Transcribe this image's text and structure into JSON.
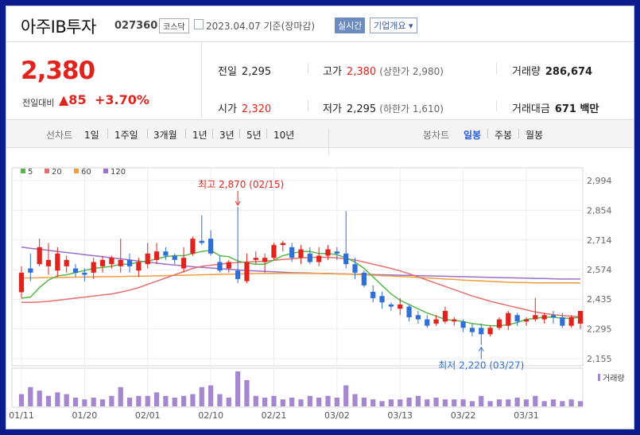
{
  "header": {
    "name": "아주IB투자",
    "code": "027360",
    "market": "코스닥",
    "date": "2023.04.07 기준(장마감)",
    "live": "실시간",
    "info": "기업개요 ▾"
  },
  "price": {
    "current": "2,380",
    "change_label": "전일대비",
    "change": "▲85",
    "percent": "+3.70%"
  },
  "stats": {
    "prev_label": "전일",
    "prev": "2,295",
    "high_label": "고가",
    "high": "2,380",
    "upper_limit": "(상한가 2,980)",
    "volume_label": "거래량",
    "volume": "286,674",
    "open_label": "시가",
    "open": "2,320",
    "low_label": "저가",
    "low": "2,295",
    "lower_limit": "(하한가 1,610)",
    "amount_label": "거래대금",
    "amount": "671 백만"
  },
  "controls": {
    "line_label": "선차트",
    "periods": [
      "1일",
      "1주일",
      "3개월",
      "1년",
      "3년",
      "5년",
      "10년"
    ],
    "candle_label": "봉차트",
    "candles": [
      "일봉",
      "주봉",
      "월봉"
    ],
    "active_candle": "일봉"
  },
  "colors": {
    "up": "#e0231c",
    "down": "#2f6fd6",
    "ma5": "#57b847",
    "ma20": "#e56f6f",
    "ma60": "#f29d3e",
    "ma120": "#9a70c9",
    "volume": "#a487cf"
  },
  "chart_data": {
    "type": "candlestick",
    "legend": [
      {
        "name": "5",
        "color": "#57b847"
      },
      {
        "name": "20",
        "color": "#e56f6f"
      },
      {
        "name": "60",
        "color": "#f29d3e"
      },
      {
        "name": "120",
        "color": "#9a70c9"
      }
    ],
    "y_ticks": [
      "2,994",
      "2,854",
      "2,714",
      "2,574",
      "2,435",
      "2,295",
      "2,155"
    ],
    "ylim": [
      2155,
      2994
    ],
    "x_ticks": [
      "01/11",
      "01/20",
      "02/01",
      "02/10",
      "02/21",
      "03/02",
      "03/13",
      "03/22",
      "03/31"
    ],
    "x_tick_index": [
      0,
      7,
      14,
      21,
      28,
      35,
      42,
      49,
      56
    ],
    "annotations": {
      "high": {
        "text": "최고 2,870 (02/15)",
        "index": 24,
        "value": 2870
      },
      "low": {
        "text": "최저 2,220 (03/27)",
        "index": 51,
        "value": 2220
      }
    },
    "volume_label": "거래량",
    "candles": [
      {
        "o": 2468,
        "h": 2590,
        "l": 2440,
        "c": 2560
      },
      {
        "o": 2580,
        "h": 2650,
        "l": 2520,
        "c": 2560
      },
      {
        "o": 2600,
        "h": 2720,
        "l": 2590,
        "c": 2680
      },
      {
        "o": 2590,
        "h": 2700,
        "l": 2550,
        "c": 2620
      },
      {
        "o": 2570,
        "h": 2680,
        "l": 2540,
        "c": 2650
      },
      {
        "o": 2590,
        "h": 2640,
        "l": 2560,
        "c": 2620
      },
      {
        "o": 2580,
        "h": 2600,
        "l": 2540,
        "c": 2560
      },
      {
        "o": 2560,
        "h": 2580,
        "l": 2520,
        "c": 2550
      },
      {
        "o": 2560,
        "h": 2630,
        "l": 2530,
        "c": 2610
      },
      {
        "o": 2590,
        "h": 2640,
        "l": 2560,
        "c": 2620
      },
      {
        "o": 2600,
        "h": 2640,
        "l": 2580,
        "c": 2630
      },
      {
        "o": 2590,
        "h": 2720,
        "l": 2560,
        "c": 2620
      },
      {
        "o": 2620,
        "h": 2650,
        "l": 2560,
        "c": 2590
      },
      {
        "o": 2570,
        "h": 2630,
        "l": 2540,
        "c": 2610
      },
      {
        "o": 2600,
        "h": 2700,
        "l": 2580,
        "c": 2650
      },
      {
        "o": 2620,
        "h": 2700,
        "l": 2600,
        "c": 2660
      },
      {
        "o": 2660,
        "h": 2680,
        "l": 2620,
        "c": 2640
      },
      {
        "o": 2640,
        "h": 2650,
        "l": 2600,
        "c": 2620
      },
      {
        "o": 2580,
        "h": 2680,
        "l": 2560,
        "c": 2630
      },
      {
        "o": 2650,
        "h": 2730,
        "l": 2640,
        "c": 2720
      },
      {
        "o": 2710,
        "h": 2830,
        "l": 2690,
        "c": 2700
      },
      {
        "o": 2720,
        "h": 2760,
        "l": 2640,
        "c": 2650
      },
      {
        "o": 2610,
        "h": 2640,
        "l": 2560,
        "c": 2570
      },
      {
        "o": 2580,
        "h": 2620,
        "l": 2560,
        "c": 2610
      },
      {
        "o": 2570,
        "h": 2870,
        "l": 2510,
        "c": 2530
      },
      {
        "o": 2520,
        "h": 2650,
        "l": 2510,
        "c": 2610
      },
      {
        "o": 2620,
        "h": 2660,
        "l": 2600,
        "c": 2630
      },
      {
        "o": 2610,
        "h": 2650,
        "l": 2560,
        "c": 2630
      },
      {
        "o": 2630,
        "h": 2700,
        "l": 2620,
        "c": 2690
      },
      {
        "o": 2690,
        "h": 2710,
        "l": 2660,
        "c": 2700
      },
      {
        "o": 2680,
        "h": 2700,
        "l": 2610,
        "c": 2630
      },
      {
        "o": 2630,
        "h": 2690,
        "l": 2600,
        "c": 2670
      },
      {
        "o": 2650,
        "h": 2680,
        "l": 2600,
        "c": 2610
      },
      {
        "o": 2610,
        "h": 2680,
        "l": 2590,
        "c": 2640
      },
      {
        "o": 2640,
        "h": 2690,
        "l": 2620,
        "c": 2670
      },
      {
        "o": 2660,
        "h": 2680,
        "l": 2620,
        "c": 2650
      },
      {
        "o": 2650,
        "h": 2850,
        "l": 2580,
        "c": 2600
      },
      {
        "o": 2600,
        "h": 2630,
        "l": 2530,
        "c": 2560
      },
      {
        "o": 2560,
        "h": 2570,
        "l": 2490,
        "c": 2500
      },
      {
        "o": 2470,
        "h": 2500,
        "l": 2420,
        "c": 2440
      },
      {
        "o": 2450,
        "h": 2470,
        "l": 2390,
        "c": 2420
      },
      {
        "o": 2410,
        "h": 2420,
        "l": 2380,
        "c": 2400
      },
      {
        "o": 2390,
        "h": 2440,
        "l": 2360,
        "c": 2410
      },
      {
        "o": 2400,
        "h": 2410,
        "l": 2330,
        "c": 2350
      },
      {
        "o": 2360,
        "h": 2380,
        "l": 2320,
        "c": 2340
      },
      {
        "o": 2340,
        "h": 2360,
        "l": 2300,
        "c": 2310
      },
      {
        "o": 2320,
        "h": 2360,
        "l": 2310,
        "c": 2340
      },
      {
        "o": 2330,
        "h": 2400,
        "l": 2320,
        "c": 2380
      },
      {
        "o": 2330,
        "h": 2350,
        "l": 2310,
        "c": 2340
      },
      {
        "o": 2330,
        "h": 2340,
        "l": 2280,
        "c": 2300
      },
      {
        "o": 2300,
        "h": 2320,
        "l": 2260,
        "c": 2280
      },
      {
        "o": 2300,
        "h": 2320,
        "l": 2220,
        "c": 2270
      },
      {
        "o": 2270,
        "h": 2310,
        "l": 2260,
        "c": 2300
      },
      {
        "o": 2300,
        "h": 2350,
        "l": 2290,
        "c": 2340
      },
      {
        "o": 2310,
        "h": 2380,
        "l": 2290,
        "c": 2370
      },
      {
        "o": 2360,
        "h": 2370,
        "l": 2310,
        "c": 2330
      },
      {
        "o": 2330,
        "h": 2350,
        "l": 2310,
        "c": 2340
      },
      {
        "o": 2340,
        "h": 2440,
        "l": 2330,
        "c": 2360
      },
      {
        "o": 2340,
        "h": 2370,
        "l": 2320,
        "c": 2360
      },
      {
        "o": 2360,
        "h": 2380,
        "l": 2320,
        "c": 2350
      },
      {
        "o": 2350,
        "h": 2370,
        "l": 2300,
        "c": 2310
      },
      {
        "o": 2310,
        "h": 2360,
        "l": 2300,
        "c": 2350
      },
      {
        "o": 2320,
        "h": 2380,
        "l": 2295,
        "c": 2380
      }
    ],
    "volume": [
      0.35,
      0.55,
      0.45,
      0.3,
      0.4,
      0.35,
      0.25,
      0.2,
      0.25,
      0.2,
      0.3,
      0.55,
      0.25,
      0.3,
      0.3,
      0.4,
      0.3,
      0.25,
      0.3,
      0.35,
      0.55,
      0.6,
      0.35,
      0.25,
      1.0,
      0.75,
      0.3,
      0.25,
      0.3,
      0.2,
      0.25,
      0.2,
      0.3,
      0.25,
      0.3,
      0.25,
      0.6,
      0.35,
      0.25,
      0.2,
      0.15,
      0.2,
      0.2,
      0.25,
      0.3,
      0.2,
      0.25,
      0.2,
      0.2,
      0.2,
      0.15,
      0.3,
      0.15,
      0.2,
      0.2,
      0.25,
      0.2,
      0.3,
      0.15,
      0.2,
      0.15,
      0.2,
      0.15
    ],
    "ma5": [
      2440,
      2445,
      2490,
      2525,
      2545,
      2550,
      2560,
      2570,
      2580,
      2585,
      2590,
      2600,
      2600,
      2610,
      2615,
      2625,
      2635,
      2640,
      2640,
      2650,
      2660,
      2665,
      2640,
      2635,
      2615,
      2605,
      2600,
      2600,
      2620,
      2640,
      2650,
      2660,
      2660,
      2650,
      2650,
      2645,
      2630,
      2610,
      2580,
      2540,
      2500,
      2460,
      2430,
      2410,
      2390,
      2370,
      2355,
      2340,
      2335,
      2330,
      2320,
      2315,
      2310,
      2310,
      2315,
      2325,
      2340,
      2345,
      2350,
      2350,
      2345,
      2345,
      2350
    ],
    "ma20": [
      2420,
      2420,
      2422,
      2425,
      2430,
      2435,
      2440,
      2445,
      2450,
      2455,
      2460,
      2468,
      2478,
      2490,
      2505,
      2520,
      2535,
      2550,
      2565,
      2580,
      2590,
      2595,
      2600,
      2605,
      2608,
      2610,
      2612,
      2615,
      2618,
      2622,
      2625,
      2630,
      2632,
      2633,
      2632,
      2630,
      2625,
      2620,
      2610,
      2600,
      2590,
      2580,
      2568,
      2555,
      2540,
      2525,
      2510,
      2495,
      2480,
      2465,
      2450,
      2438,
      2425,
      2415,
      2405,
      2395,
      2385,
      2375,
      2368,
      2362,
      2358,
      2355,
      2352
    ],
    "ma60": [
      2535,
      2535,
      2536,
      2537,
      2537,
      2538,
      2539,
      2540,
      2540,
      2541,
      2541,
      2542,
      2543,
      2543,
      2544,
      2545,
      2546,
      2547,
      2548,
      2549,
      2550,
      2551,
      2552,
      2553,
      2554,
      2555,
      2556,
      2556,
      2557,
      2557,
      2557,
      2557,
      2556,
      2556,
      2555,
      2554,
      2553,
      2552,
      2550,
      2548,
      2546,
      2544,
      2542,
      2540,
      2538,
      2535,
      2533,
      2530,
      2528,
      2525,
      2523,
      2521,
      2519,
      2517,
      2515,
      2514,
      2513,
      2512,
      2512,
      2512,
      2512,
      2512,
      2512
    ],
    "ma120": [
      2680,
      2675,
      2670,
      2665,
      2660,
      2655,
      2650,
      2645,
      2640,
      2635,
      2630,
      2625,
      2620,
      2615,
      2610,
      2605,
      2600,
      2596,
      2592,
      2588,
      2585,
      2582,
      2579,
      2576,
      2573,
      2570,
      2568,
      2566,
      2564,
      2562,
      2560,
      2559,
      2558,
      2557,
      2556,
      2555,
      2554,
      2553,
      2552,
      2551,
      2550,
      2549,
      2548,
      2547,
      2546,
      2545,
      2544,
      2543,
      2542,
      2541,
      2540,
      2539,
      2538,
      2537,
      2536,
      2535,
      2534,
      2533,
      2532,
      2531,
      2530,
      2530,
      2530
    ]
  }
}
